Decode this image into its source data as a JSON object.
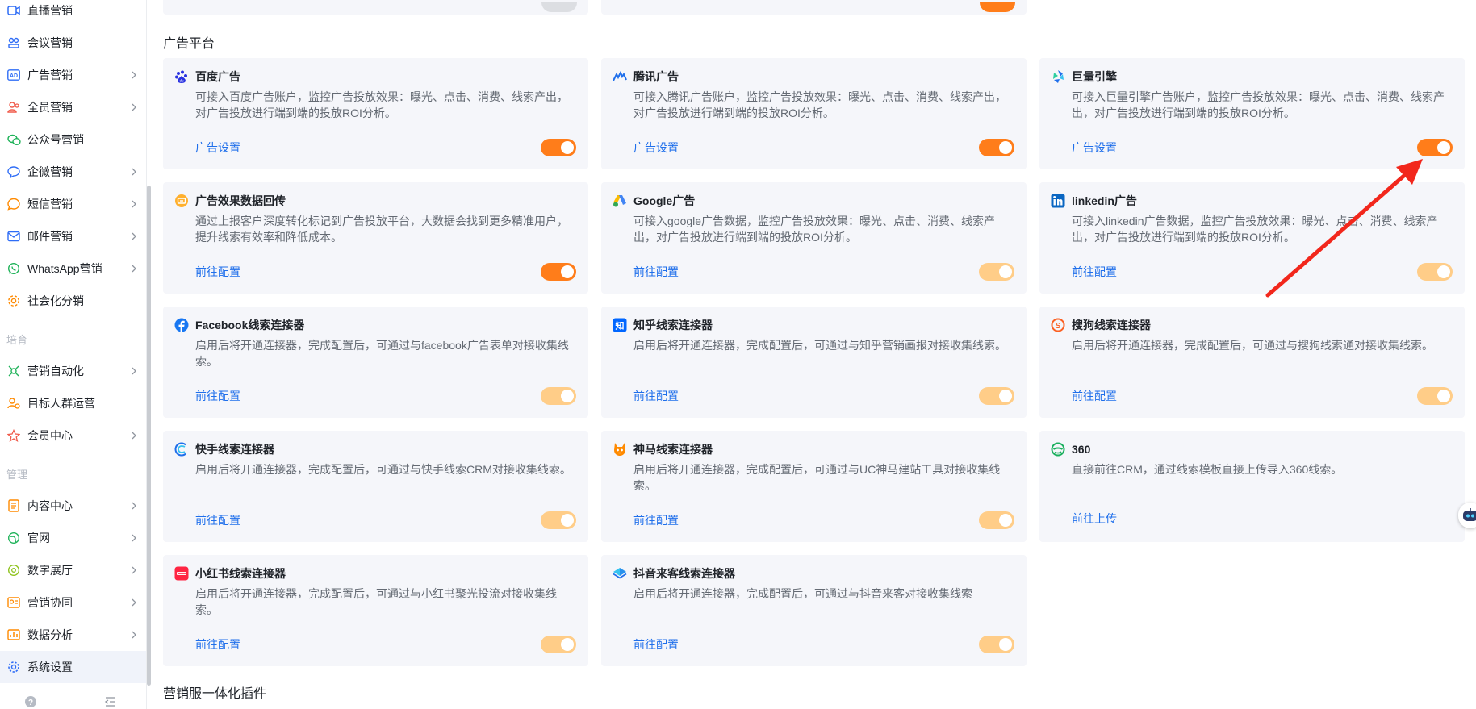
{
  "sidebar": {
    "items": [
      {
        "label": "直播营销",
        "icon": "video-icon",
        "chevron": false,
        "color": "#2f6df6"
      },
      {
        "label": "会议营销",
        "icon": "meeting-icon",
        "chevron": false,
        "color": "#2f6df6"
      },
      {
        "label": "广告营销",
        "icon": "ad-icon",
        "chevron": true,
        "color": "#2f6df6"
      },
      {
        "label": "全员营销",
        "icon": "people-icon",
        "chevron": true,
        "color": "#f05a4a"
      },
      {
        "label": "公众号营销",
        "icon": "wechat-icon",
        "chevron": false,
        "color": "#20b35a"
      },
      {
        "label": "企微营销",
        "icon": "chat-icon",
        "chevron": true,
        "color": "#2f6df6"
      },
      {
        "label": "短信营销",
        "icon": "sms-icon",
        "chevron": true,
        "color": "#ff8a00"
      },
      {
        "label": "邮件营销",
        "icon": "mail-icon",
        "chevron": true,
        "color": "#2f6df6"
      },
      {
        "label": "WhatsApp营销",
        "icon": "whatsapp-icon",
        "chevron": true,
        "color": "#20b35a"
      },
      {
        "label": "社会化分销",
        "icon": "distribution-icon",
        "chevron": false,
        "color": "#ff8a00"
      },
      {
        "label": "营销自动化",
        "icon": "automation-icon",
        "chevron": true,
        "color": "#20b35a"
      },
      {
        "label": "目标人群运营",
        "icon": "audience-icon",
        "chevron": false,
        "color": "#ff8a00"
      },
      {
        "label": "会员中心",
        "icon": "member-icon",
        "chevron": true,
        "color": "#f05a4a"
      },
      {
        "label": "内容中心",
        "icon": "content-icon",
        "chevron": true,
        "color": "#ff8a00"
      },
      {
        "label": "官网",
        "icon": "website-icon",
        "chevron": true,
        "color": "#20b35a"
      },
      {
        "label": "数字展厅",
        "icon": "showroom-icon",
        "chevron": true,
        "color": "#8fc31f"
      },
      {
        "label": "营销协同",
        "icon": "collab-icon",
        "chevron": true,
        "color": "#ff8a00"
      },
      {
        "label": "数据分析",
        "icon": "analytics-icon",
        "chevron": true,
        "color": "#ff8a00"
      },
      {
        "label": "系统设置",
        "icon": "gear-icon",
        "chevron": false,
        "color": "#2f6df6"
      }
    ],
    "sections": {
      "nurture": "培育",
      "manage": "管理"
    }
  },
  "main": {
    "section_ad_platform": "广告平台",
    "section_plugins": "营销服一体化插件",
    "cards": [
      {
        "title": "百度广告",
        "desc": "可接入百度广告账户，监控广告投放效果：曝光、点击、消费、线索产出，对广告投放进行端到端的投放ROI分析。",
        "link": "广告设置",
        "toggle": "on",
        "icon": "baidu-icon"
      },
      {
        "title": "腾讯广告",
        "desc": "可接入腾讯广告账户，监控广告投放效果：曝光、点击、消费、线索产出，对广告投放进行端到端的投放ROI分析。",
        "link": "广告设置",
        "toggle": "on",
        "icon": "tencent-ads-icon"
      },
      {
        "title": "巨量引擎",
        "desc": "可接入巨量引擎广告账户，监控广告投放效果：曝光、点击、消费、线索产出，对广告投放进行端到端的投放ROI分析。",
        "link": "广告设置",
        "toggle": "on",
        "icon": "ocean-engine-icon"
      },
      {
        "title": "广告效果数据回传",
        "desc": "通过上报客户深度转化标记到广告投放平台，大数据会找到更多精准用户，提升线索有效率和降低成本。",
        "link": "前往配置",
        "toggle": "on",
        "icon": "data-return-icon"
      },
      {
        "title": "Google广告",
        "desc": "可接入google广告数据，监控广告投放效果：曝光、点击、消费、线索产出，对广告投放进行端到端的投放ROI分析。",
        "link": "前往配置",
        "toggle": "dim",
        "icon": "google-ads-icon"
      },
      {
        "title": "linkedin广告",
        "desc": "可接入linkedin广告数据，监控广告投放效果：曝光、点击、消费、线索产出，对广告投放进行端到端的投放ROI分析。",
        "link": "前往配置",
        "toggle": "dim",
        "icon": "linkedin-icon"
      },
      {
        "title": "Facebook线索连接器",
        "desc": "启用后将开通连接器，完成配置后，可通过与facebook广告表单对接收集线索。",
        "link": "前往配置",
        "toggle": "dim",
        "icon": "facebook-icon"
      },
      {
        "title": "知乎线索连接器",
        "desc": "启用后将开通连接器，完成配置后，可通过与知乎营销画报对接收集线索。",
        "link": "前往配置",
        "toggle": "dim",
        "icon": "zhihu-icon"
      },
      {
        "title": "搜狗线索连接器",
        "desc": "启用后将开通连接器，完成配置后，可通过与搜狗线索通对接收集线索。",
        "link": "前往配置",
        "toggle": "dim",
        "icon": "sogou-icon"
      },
      {
        "title": "快手线索连接器",
        "desc": "启用后将开通连接器，完成配置后，可通过与快手线索CRM对接收集线索。",
        "link": "前往配置",
        "toggle": "dim",
        "icon": "kuaishou-icon"
      },
      {
        "title": "神马线索连接器",
        "desc": "启用后将开通连接器，完成配置后，可通过与UC神马建站工具对接收集线索。",
        "link": "前往配置",
        "toggle": "dim",
        "icon": "shenma-icon"
      },
      {
        "title": "360",
        "desc": "直接前往CRM，通过线索模板直接上传导入360线索。",
        "link": "前往上传",
        "toggle": "none",
        "icon": "360-icon"
      },
      {
        "title": "小红书线索连接器",
        "desc": "启用后将开通连接器，完成配置后，可通过与小红书聚光投流对接收集线索。",
        "link": "前往配置",
        "toggle": "dim",
        "icon": "xiaohongshu-icon"
      },
      {
        "title": "抖音来客线索连接器",
        "desc": "启用后将开通连接器，完成配置后，可通过与抖音来客对接收集线索",
        "link": "前往配置",
        "toggle": "dim",
        "icon": "douyin-laike-icon"
      }
    ]
  },
  "colors": {
    "accent": "#1f6feb",
    "toggle_on": "#ff7d1a",
    "toggle_dim": "#ffcd88",
    "card_bg": "#f5f6fa",
    "annotation_arrow": "#f2271c"
  }
}
